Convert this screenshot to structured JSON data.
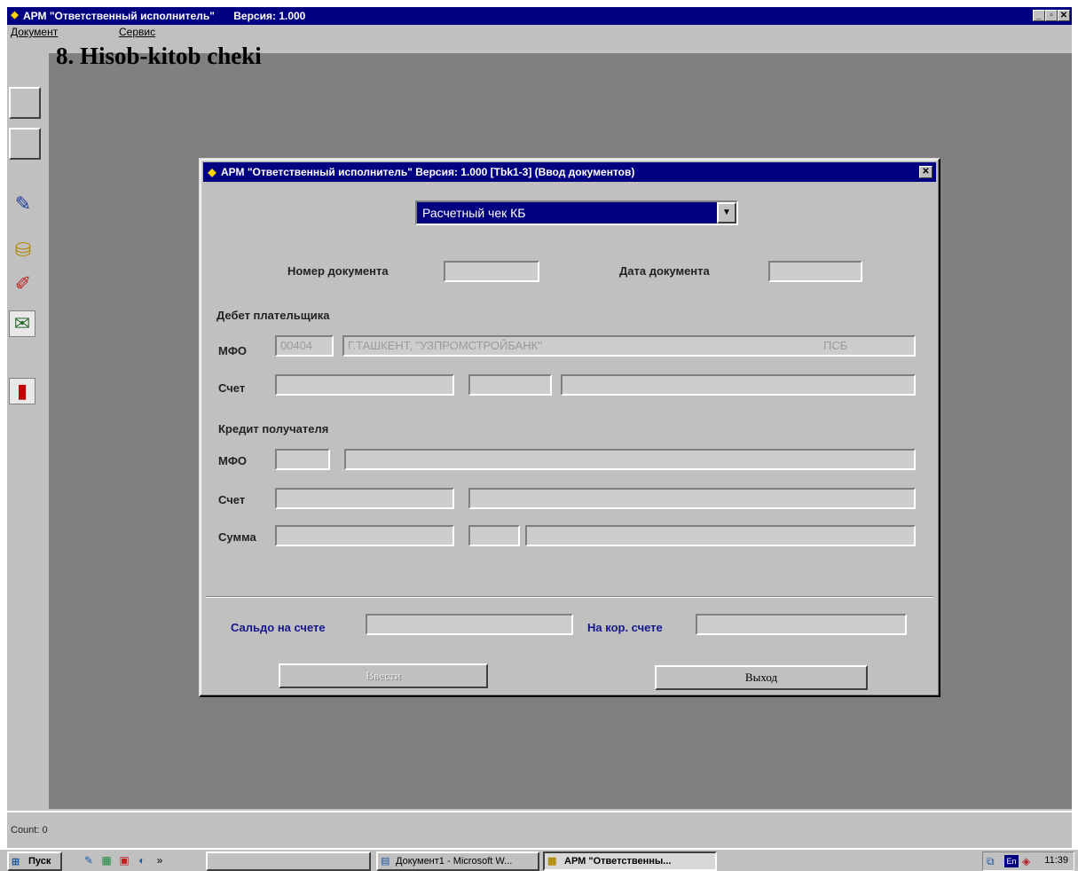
{
  "window": {
    "title": "АРМ \"Ответственный исполнитель\"",
    "version": "Версия: 1.000",
    "controls": [
      "_",
      "▫",
      "✕"
    ]
  },
  "menu": [
    "Документ",
    "Сервис"
  ],
  "heading": "8. Hisob-kitob cheki",
  "toolbar": [
    "blank-button",
    "blank-button",
    "help-icon",
    "coins-icon",
    "document-edit-icon",
    "report-icon",
    "exit-door-icon"
  ],
  "dialog": {
    "title": "АРМ \"Ответственный исполнитель\" Версия: 1.000 [Tbk1-3] (Ввод документов)",
    "close": "✕",
    "doc_type": "Расчетный чек КБ",
    "doc_number_label": "Номер документа",
    "doc_number": "",
    "doc_date_label": "Дата документа",
    "doc_date": "",
    "debit_section": "Дебет плательщика",
    "debit_mfo_label": "МФО",
    "debit_mfo": "00404",
    "debit_bank": "Г.ТАШКЕНТ, \"УЗПРОМСТРОЙБАНК\"",
    "debit_bank_code": "ПСБ",
    "debit_account_label": "Счет",
    "credit_section": "Кредит получателя",
    "credit_mfo_label": "МФО",
    "credit_account_label": "Счет",
    "amount_label": "Сумма",
    "balance_label": "Сальдо на счете",
    "corr_label": "На кор. счете",
    "enter_button": "Ввести",
    "exit_button": "Выход"
  },
  "status": "Count: 0",
  "taskbar": {
    "start": "Пуск",
    "tasks": [
      "Документ1 - Microsoft W...",
      "АРМ \"Ответственны..."
    ],
    "clock": "11:39",
    "lang": "En"
  }
}
